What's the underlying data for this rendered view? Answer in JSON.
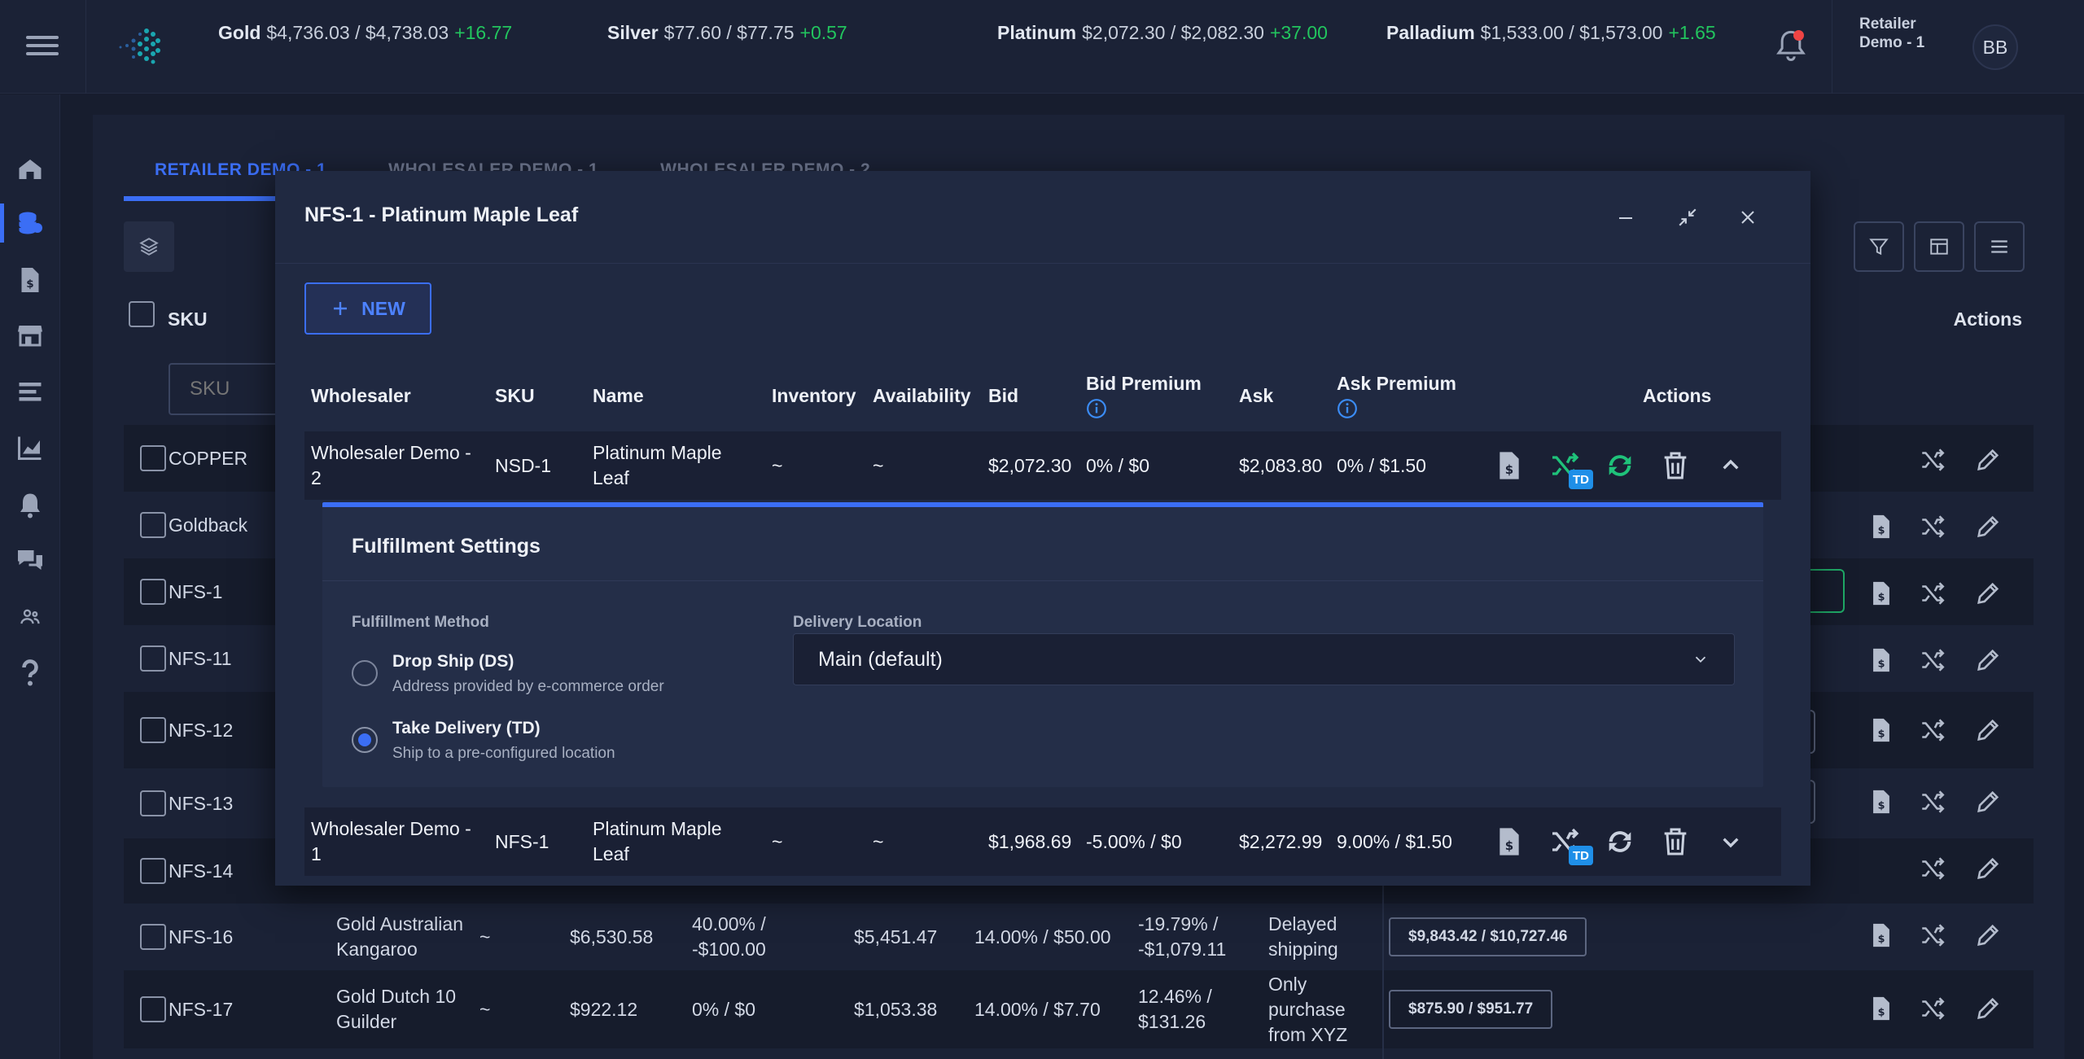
{
  "topbar": {
    "metals": [
      {
        "name": "Gold",
        "value": "$4,736.03 / $4,738.03",
        "change": "+16.77"
      },
      {
        "name": "Silver",
        "value": "$77.60 / $77.75",
        "change": "+0.57"
      },
      {
        "name": "Platinum",
        "value": "$2,072.30 / $2,082.30",
        "change": "+37.00"
      },
      {
        "name": "Palladium",
        "value": "$1,533.00 / $1,573.00",
        "change": "+1.65"
      }
    ],
    "retailer": "Retailer Demo - 1",
    "avatar": "BB"
  },
  "tabs": [
    "RETAILER DEMO - 1",
    "WHOLESALER DEMO - 1",
    "WHOLESALER DEMO - 2"
  ],
  "grid": {
    "sku_header": "SKU",
    "actions_header": "Actions",
    "sku_placeholder": "SKU",
    "rows": [
      {
        "sku": "COPPER"
      },
      {
        "sku": "Goldback"
      },
      {
        "sku": "NFS-1"
      },
      {
        "sku": "NFS-11"
      },
      {
        "sku": "NFS-12"
      },
      {
        "sku": "NFS-13"
      },
      {
        "sku": "NFS-14"
      },
      {
        "sku": "NFS-16",
        "name": "Gold Australian Kangaroo",
        "inventory": "~",
        "bid": "$6,530.58",
        "bid_premium": "40.00% / -$100.00",
        "ask": "$5,451.47",
        "ask_premium": "14.00% / $50.00",
        "diff": "-19.79% / -$1,079.11",
        "note": "Delayed shipping",
        "pill": "$9,843.42 / $10,727.46"
      },
      {
        "sku": "NFS-17",
        "name": "Gold Dutch 10 Guilder",
        "inventory": "~",
        "bid": "$922.12",
        "bid_premium": "0% / $0",
        "ask": "$1,053.38",
        "ask_premium": "14.00% / $7.70",
        "diff": "12.46% / $131.26",
        "note": "Only purchase from XYZ",
        "pill": "$875.90 / $951.77"
      }
    ]
  },
  "modal": {
    "title": "NFS-1 - Platinum Maple Leaf",
    "new_label": "NEW",
    "columns": [
      "Wholesaler",
      "SKU",
      "Name",
      "Inventory",
      "Availability",
      "Bid",
      "Bid Premium",
      "Ask",
      "Ask Premium",
      "Actions"
    ],
    "rows": [
      {
        "wholesaler": "Wholesaler Demo - 2",
        "sku": "NSD-1",
        "name": "Platinum Maple Leaf",
        "inventory": "~",
        "availability": "~",
        "bid": "$2,072.30",
        "bid_premium": "0% / $0",
        "ask": "$2,083.80",
        "ask_premium": "0% / $1.50",
        "badge": "TD"
      },
      {
        "wholesaler": "Wholesaler Demo - 1",
        "sku": "NFS-1",
        "name": "Platinum Maple Leaf",
        "inventory": "~",
        "availability": "~",
        "bid": "$1,968.69",
        "bid_premium": "-5.00% / $0",
        "ask": "$2,272.99",
        "ask_premium": "9.00% / $1.50",
        "badge": "TD"
      }
    ],
    "fulfillment": {
      "title": "Fulfillment Settings",
      "method_label": "Fulfillment Method",
      "options": [
        {
          "title": "Drop Ship (DS)",
          "subtitle": "Address provided by e-commerce order",
          "selected": false
        },
        {
          "title": "Take Delivery (TD)",
          "subtitle": "Ship to a pre-configured location",
          "selected": true
        }
      ],
      "location_label": "Delivery Location",
      "location_value": "Main (default)"
    }
  },
  "colors": {
    "accent": "#3b6ef5",
    "positive": "#22c55e",
    "green_icon": "#1fc27a",
    "badge": "#1f8fe8"
  }
}
